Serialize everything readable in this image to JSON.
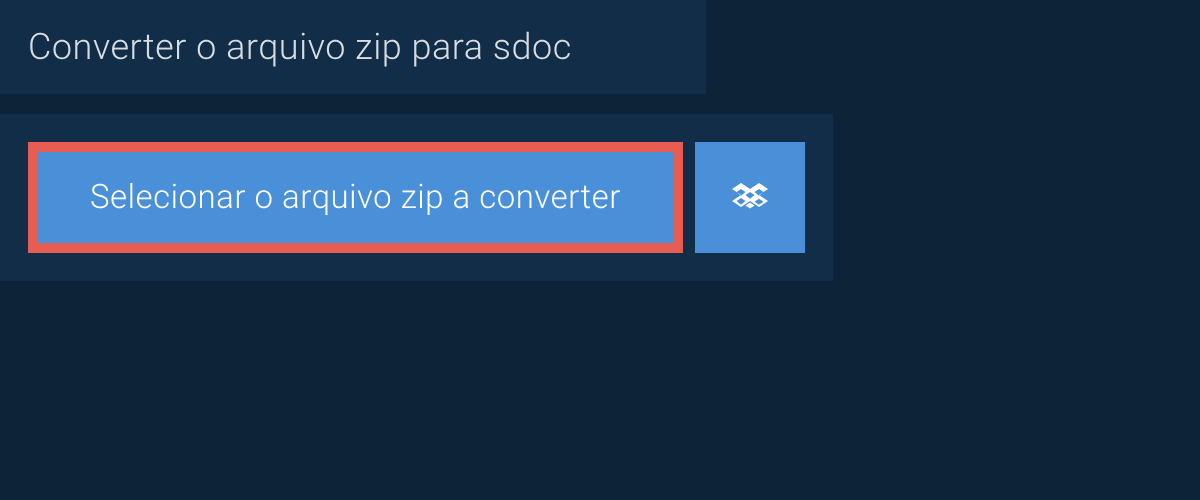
{
  "header": {
    "title": "Converter o arquivo zip para sdoc"
  },
  "actions": {
    "select_file_label": "Selecionar o arquivo zip a converter",
    "dropbox_icon": "dropbox-icon"
  }
}
